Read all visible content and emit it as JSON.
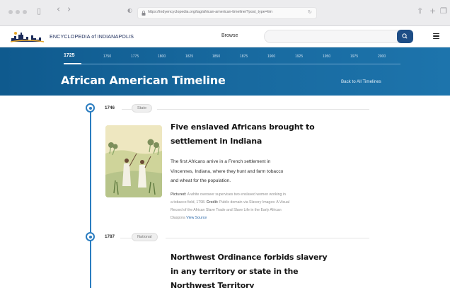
{
  "browser": {
    "url": "https://indyencyclopedia.org/tag/african-american-timeline/?post_type=tim",
    "back_glyph": "‹",
    "forward_glyph": "›",
    "sidebar_glyph": "▯",
    "reload_glyph": "↻",
    "share_glyph": "⇧",
    "new_tab_glyph": "+",
    "tabs_glyph": "❐"
  },
  "site": {
    "logo_text": "ENCYCLOPEDIA of INDIANAPOLIS",
    "browse_label": "Browse",
    "search": {
      "placeholder": "",
      "button_glyph": "⚲"
    },
    "colors": {
      "brand_blue": "#1d4d86",
      "accent_blue": "#2b7dc0"
    }
  },
  "timeline_nav": {
    "decades": [
      "1725",
      "1750",
      "1775",
      "1800",
      "1825",
      "1850",
      "1875",
      "1900",
      "1925",
      "1950",
      "1975",
      "2000"
    ],
    "active_decade": "1725"
  },
  "page": {
    "title": "African American Timeline",
    "back_link": "Back to All Timelines"
  },
  "entries": [
    {
      "year": "1746",
      "tag": "State",
      "title_line1": "Five enslaved Africans brought to",
      "title_line2": "settlement in Indiana",
      "body_line1": "The first Africans arrive in a French settlement in",
      "body_line2": "Vincennes, Indiana, where they hunt and farm tobacco",
      "body_line3": "and wheat for the population.",
      "credit_pictured_label": "Pictured:",
      "credit_line1": "A white overseer supervises two enslaved women working in",
      "credit_line2_pre": "a tobacco field, 1798.",
      "credit_label": "Credit:",
      "credit_line2_post": "Public domain via Slavery Images: A Visual",
      "credit_line3": "Record of the African Slave Trade and Slave Life in the Early African",
      "credit_line4_pre": "Diaspora",
      "view_source": "View Source"
    },
    {
      "year": "1787",
      "tag": "National",
      "title_line1": "Northwest Ordinance forbids slavery",
      "title_line2": "in any territory or state in the",
      "title_line3": "Northwest Territory"
    }
  ]
}
